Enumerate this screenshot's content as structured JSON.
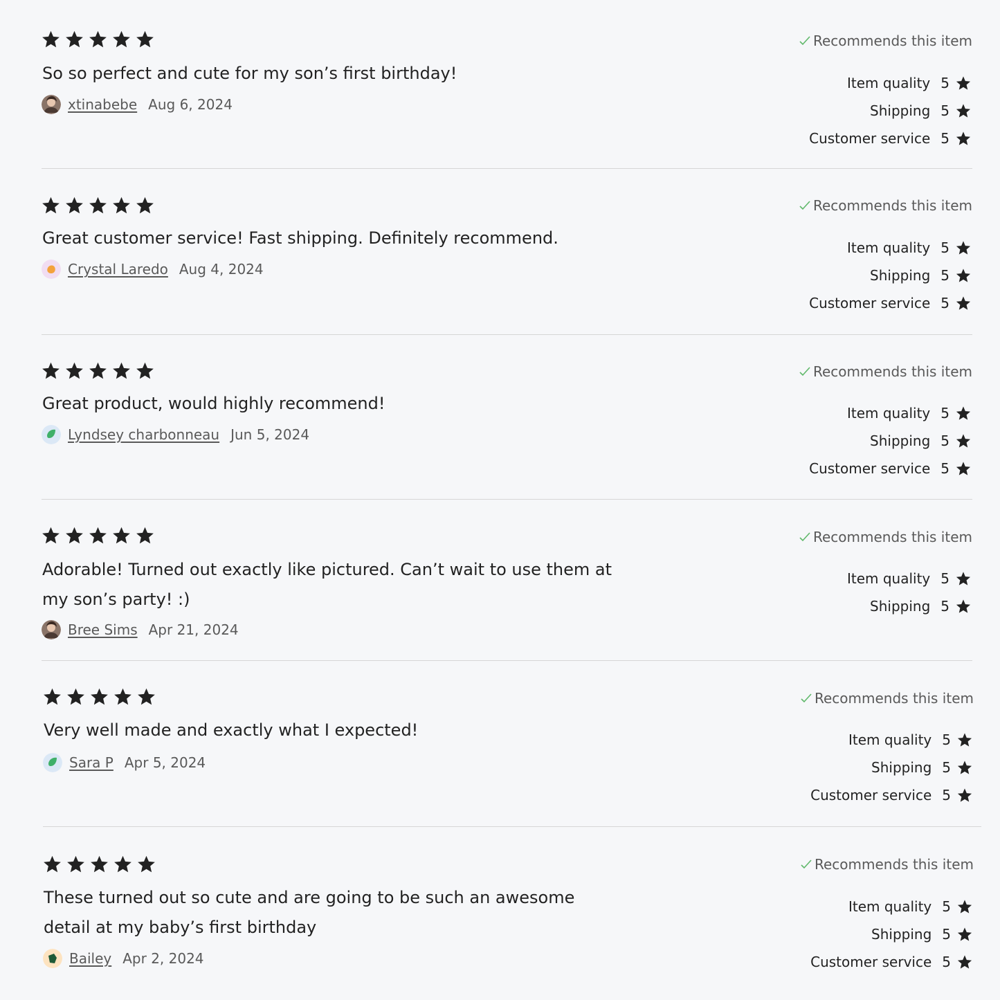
{
  "recommend_label": "Recommends this item",
  "accent_check_color": "#5fb86a",
  "reviews": [
    {
      "rating": 5,
      "text": "So so perfect and cute for my son’s first birthday!",
      "author": "xtinabebe",
      "date": "Aug 6, 2024",
      "avatar_icon": "photo-avatar-icon",
      "ratings": [
        {
          "label": "Item quality",
          "value": "5"
        },
        {
          "label": "Shipping",
          "value": "5"
        },
        {
          "label": "Customer service",
          "value": "5"
        }
      ]
    },
    {
      "rating": 5,
      "text": "Great customer service! Fast shipping. Definitely recommend.",
      "author": "Crystal Laredo",
      "date": "Aug 4, 2024",
      "avatar_icon": "orange-leaf-avatar-icon",
      "ratings": [
        {
          "label": "Item quality",
          "value": "5"
        },
        {
          "label": "Shipping",
          "value": "5"
        },
        {
          "label": "Customer service",
          "value": "5"
        }
      ]
    },
    {
      "rating": 5,
      "text": "Great product, would highly recommend!",
      "author": "Lyndsey charbonneau",
      "date": "Jun 5, 2024",
      "avatar_icon": "green-leaf-avatar-icon",
      "ratings": [
        {
          "label": "Item quality",
          "value": "5"
        },
        {
          "label": "Shipping",
          "value": "5"
        },
        {
          "label": "Customer service",
          "value": "5"
        }
      ]
    },
    {
      "rating": 5,
      "text": "Adorable! Turned out exactly like pictured. Can’t wait to use them at my son’s party! :)",
      "author": "Bree Sims",
      "date": "Apr 21, 2024",
      "avatar_icon": "photo-avatar-icon",
      "ratings": [
        {
          "label": "Item quality",
          "value": "5"
        },
        {
          "label": "Shipping",
          "value": "5"
        }
      ]
    },
    {
      "rating": 5,
      "text": "Very well made and exactly what I expected!",
      "author": "Sara P",
      "date": "Apr 5, 2024",
      "avatar_icon": "green-leaf-avatar-icon",
      "ratings": [
        {
          "label": "Item quality",
          "value": "5"
        },
        {
          "label": "Shipping",
          "value": "5"
        },
        {
          "label": "Customer service",
          "value": "5"
        }
      ]
    },
    {
      "rating": 5,
      "text": "These turned out so cute and are going to be such an awesome detail at my baby’s first birthday",
      "author": "Bailey",
      "date": "Apr 2, 2024",
      "avatar_icon": "dark-green-leaf-avatar-icon",
      "ratings": [
        {
          "label": "Item quality",
          "value": "5"
        },
        {
          "label": "Shipping",
          "value": "5"
        },
        {
          "label": "Customer service",
          "value": "5"
        }
      ]
    }
  ]
}
